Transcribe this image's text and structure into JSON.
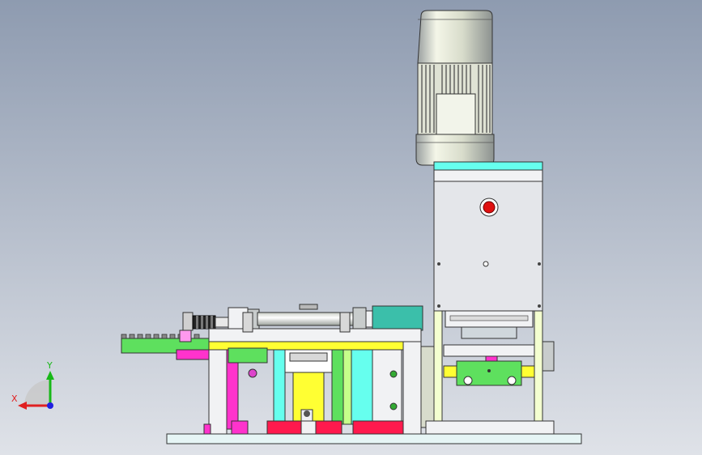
{
  "viewport": {
    "background_top": "#8e9bb0",
    "background_bottom": "#dfe2e8"
  },
  "triad": {
    "x_label": "X",
    "y_label": "Y",
    "x_color": "#e02020",
    "y_color": "#18b818",
    "z_color": "#2020e0"
  },
  "model": {
    "parts": [
      "motor-housing",
      "motor-cooling-fins",
      "gearbox",
      "motor-mount-plate",
      "control-box",
      "emergency-stop-button",
      "pneumatic-cylinder",
      "cylinder-rod-end",
      "feed-conveyor",
      "top-plate",
      "slide-block",
      "guide-rails",
      "support-columns",
      "base-plate"
    ],
    "colors": {
      "steel": "#d9dce0",
      "white_part": "#f1f2f4",
      "yellow": "#ffff33",
      "green": "#5ee05e",
      "magenta": "#ff33cc",
      "red": "#ff1a4d",
      "cyan": "#66ffee",
      "teal": "#3bbfaa",
      "button_red": "#e01010"
    }
  }
}
